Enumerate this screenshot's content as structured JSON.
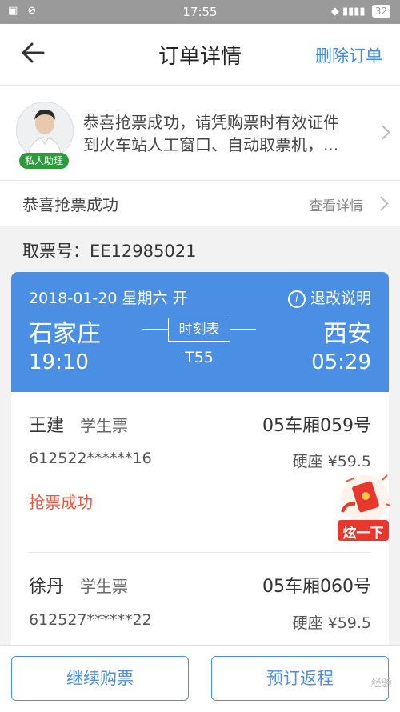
{
  "status_bar": {
    "time": "17:55",
    "battery": "32"
  },
  "header": {
    "title": "订单详情",
    "delete_label": "删除订单"
  },
  "assistant": {
    "badge": "私人助理",
    "message_line1": "恭喜抢票成功，请凭购票时有效证件",
    "message_line2": "到火车站人工窗口、自动取票机，..."
  },
  "success_row": {
    "label": "恭喜抢票成功",
    "details_link": "查看详情"
  },
  "pickup": {
    "label": "取票号：EE12985021"
  },
  "ticket": {
    "date_line": "2018-01-20 星期六 开",
    "refund_label": "退改说明",
    "from_station": "石家庄",
    "to_station": "西安",
    "schedule_label": "时刻表",
    "train_no": "T55",
    "depart_time": "19:10",
    "arrive_time": "05:29"
  },
  "passengers": [
    {
      "name": "王建",
      "ticket_type": "学生票",
      "seat": "05车厢059号",
      "id_no": "612522******16",
      "seat_class": "硬座  ¥59.5",
      "status": "抢票成功"
    },
    {
      "name": "徐丹",
      "ticket_type": "学生票",
      "seat": "05车厢060号",
      "id_no": "612527******22",
      "seat_class": "硬座  ¥59.5"
    }
  ],
  "promo": {
    "label": "炫一下"
  },
  "footer": {
    "continue_label": "继续购票",
    "return_label": "预订返程",
    "watermark": "经验"
  },
  "colors": {
    "accent": "#4a8fe4",
    "success_status": "#f0553a",
    "assistant_badge": "#2c9b3c"
  }
}
